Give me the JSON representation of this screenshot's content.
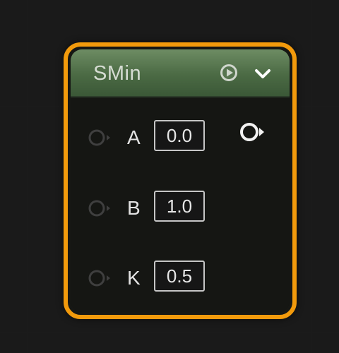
{
  "node": {
    "title": "SMin",
    "header_color": "#4b6a44",
    "border_color": "#f29a0c",
    "icons": {
      "play": "play-circle-icon",
      "collapse": "chevron-down-icon",
      "output": "output-pin-icon"
    },
    "inputs": [
      {
        "label": "A",
        "value": "0.0"
      },
      {
        "label": "B",
        "value": "1.0"
      },
      {
        "label": "K",
        "value": "0.5"
      }
    ]
  }
}
